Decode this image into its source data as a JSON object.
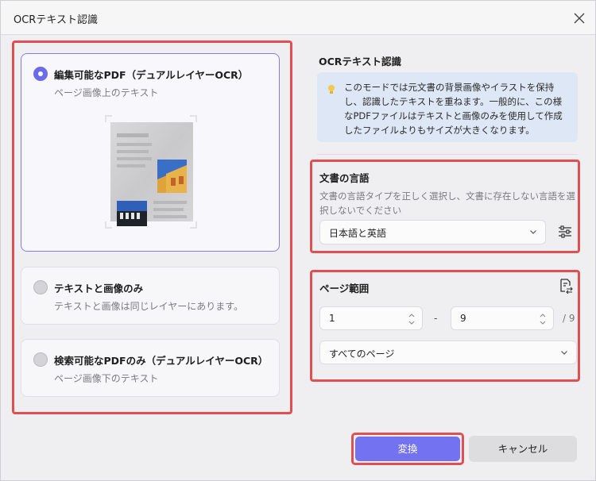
{
  "window": {
    "title": "OCRテキスト認識"
  },
  "options": [
    {
      "title": "編集可能なPDF（デュアルレイヤーOCR）",
      "subtitle": "ページ画像上のテキスト",
      "selected": true
    },
    {
      "title": "テキストと画像のみ",
      "subtitle": "テキストと画像は同じレイヤーにあります。",
      "selected": false
    },
    {
      "title": "検索可能なPDFのみ（デュアルレイヤーOCR）",
      "subtitle": "ページ画像下のテキスト",
      "selected": false
    }
  ],
  "right": {
    "heading": "OCRテキスト認識",
    "info": "このモードでは元文書の背景画像やイラストを保持し、認識したテキストを重ねます。一般的に、この様なPDFファイルはテキストと画像のみを使用して作成したファイルよりもサイズが大きくなります。",
    "language": {
      "title": "文書の言語",
      "description": "文書の言語タイプを正しく選択し、文書に存在しない言語を選択しないでください",
      "selected": "日本語と英語"
    },
    "page_range": {
      "title": "ページ範囲",
      "from": "1",
      "separator": "-",
      "to": "9",
      "total": "/ 9",
      "range_option": "すべてのページ"
    }
  },
  "buttons": {
    "convert": "変換",
    "cancel": "キャンセル"
  },
  "colors": {
    "accent": "#7372f0",
    "highlight": "#e14f53",
    "info_bg": "#dde7f6"
  }
}
